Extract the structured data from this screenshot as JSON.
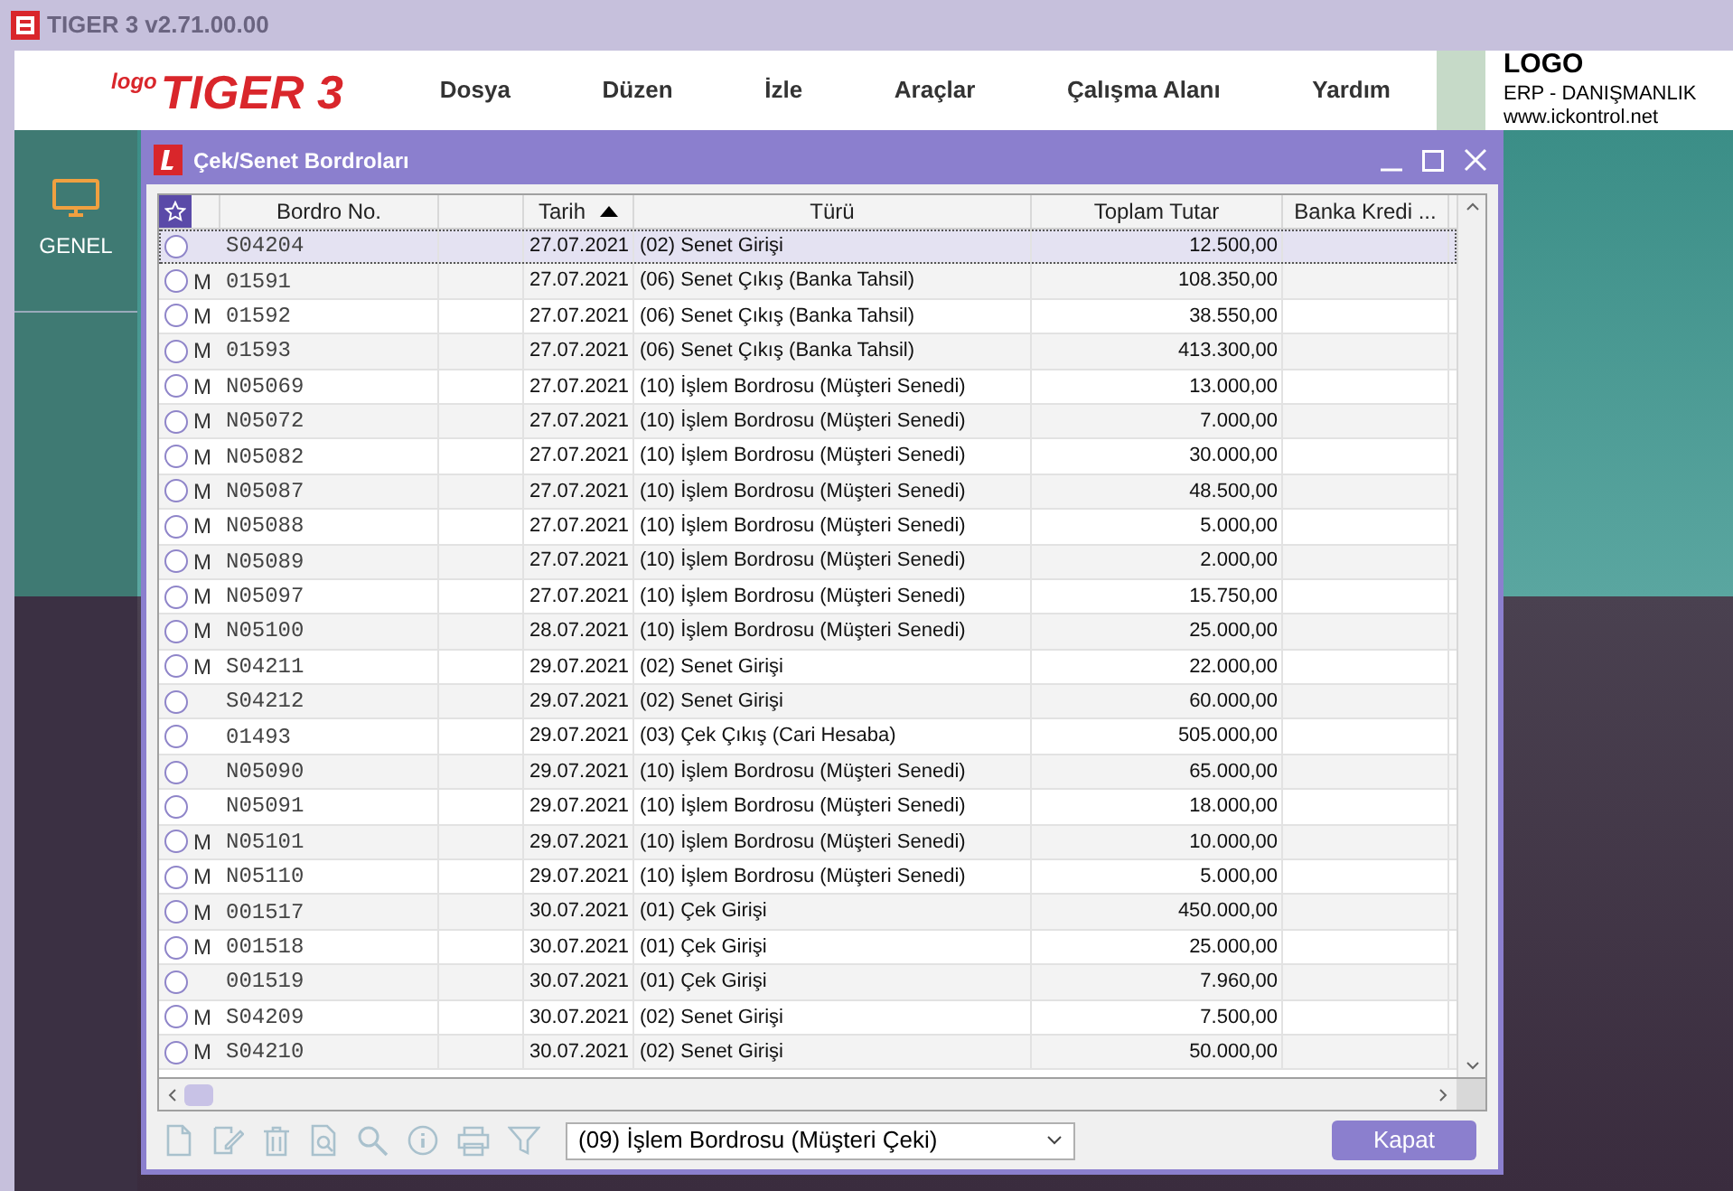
{
  "window": {
    "title": "TIGER 3 v2.71.00.00"
  },
  "brand": {
    "small": "logo",
    "name": "TIGER 3"
  },
  "menu": [
    {
      "label": "Dosya"
    },
    {
      "label": "Düzen"
    },
    {
      "label": "İzle"
    },
    {
      "label": "Araçlar"
    },
    {
      "label": "Çalışma Alanı"
    },
    {
      "label": "Yardım"
    }
  ],
  "company": {
    "name": "LOGO",
    "line": "ERP - DANIŞMANLIK",
    "site": "www.ickontrol.net"
  },
  "sidebar": {
    "items": [
      {
        "label": "GENEL",
        "selected": true
      }
    ]
  },
  "dialog": {
    "title": "Çek/Senet Bordroları",
    "columns": [
      {
        "label": "Bordro No.",
        "sorted": false
      },
      {
        "label": "Tarih",
        "sorted": true
      },
      {
        "label": "Türü",
        "sorted": false
      },
      {
        "label": "Toplam Tutar",
        "sorted": false
      },
      {
        "label": "Banka Kredi ...",
        "sorted": false
      }
    ],
    "rows": [
      {
        "m": "",
        "no": "S04204",
        "date": "27.07.2021",
        "type": "(02) Senet Girişi",
        "amount": "12.500,00",
        "selected": true,
        "checked": false
      },
      {
        "m": "M",
        "no": "01591",
        "date": "27.07.2021",
        "type": "(06) Senet Çıkış (Banka Tahsil)",
        "amount": "108.350,00",
        "selected": false,
        "checked": false
      },
      {
        "m": "M",
        "no": "01592",
        "date": "27.07.2021",
        "type": "(06) Senet Çıkış (Banka Tahsil)",
        "amount": "38.550,00",
        "selected": false,
        "checked": false
      },
      {
        "m": "M",
        "no": "01593",
        "date": "27.07.2021",
        "type": "(06) Senet Çıkış (Banka Tahsil)",
        "amount": "413.300,00",
        "selected": false,
        "checked": false
      },
      {
        "m": "M",
        "no": "N05069",
        "date": "27.07.2021",
        "type": "(10) İşlem Bordrosu (Müşteri Senedi)",
        "amount": "13.000,00",
        "selected": false,
        "checked": false
      },
      {
        "m": "M",
        "no": "N05072",
        "date": "27.07.2021",
        "type": "(10) İşlem Bordrosu (Müşteri Senedi)",
        "amount": "7.000,00",
        "selected": false,
        "checked": false
      },
      {
        "m": "M",
        "no": "N05082",
        "date": "27.07.2021",
        "type": "(10) İşlem Bordrosu (Müşteri Senedi)",
        "amount": "30.000,00",
        "selected": false,
        "checked": false
      },
      {
        "m": "M",
        "no": "N05087",
        "date": "27.07.2021",
        "type": "(10) İşlem Bordrosu (Müşteri Senedi)",
        "amount": "48.500,00",
        "selected": false,
        "checked": false
      },
      {
        "m": "M",
        "no": "N05088",
        "date": "27.07.2021",
        "type": "(10) İşlem Bordrosu (Müşteri Senedi)",
        "amount": "5.000,00",
        "selected": false,
        "checked": false
      },
      {
        "m": "M",
        "no": "N05089",
        "date": "27.07.2021",
        "type": "(10) İşlem Bordrosu (Müşteri Senedi)",
        "amount": "2.000,00",
        "selected": false,
        "checked": false
      },
      {
        "m": "M",
        "no": "N05097",
        "date": "27.07.2021",
        "type": "(10) İşlem Bordrosu (Müşteri Senedi)",
        "amount": "15.750,00",
        "selected": false,
        "checked": false
      },
      {
        "m": "M",
        "no": "N05100",
        "date": "28.07.2021",
        "type": "(10) İşlem Bordrosu (Müşteri Senedi)",
        "amount": "25.000,00",
        "selected": false,
        "checked": false
      },
      {
        "m": "M",
        "no": "S04211",
        "date": "29.07.2021",
        "type": "(02) Senet Girişi",
        "amount": "22.000,00",
        "selected": false,
        "checked": false
      },
      {
        "m": "",
        "no": "S04212",
        "date": "29.07.2021",
        "type": "(02) Senet Girişi",
        "amount": "60.000,00",
        "selected": false,
        "checked": false
      },
      {
        "m": "",
        "no": "01493",
        "date": "29.07.2021",
        "type": "(03) Çek Çıkış (Cari Hesaba)",
        "amount": "505.000,00",
        "selected": false,
        "checked": false
      },
      {
        "m": "",
        "no": "N05090",
        "date": "29.07.2021",
        "type": "(10) İşlem Bordrosu (Müşteri Senedi)",
        "amount": "65.000,00",
        "selected": false,
        "checked": false
      },
      {
        "m": "",
        "no": "N05091",
        "date": "29.07.2021",
        "type": "(10) İşlem Bordrosu (Müşteri Senedi)",
        "amount": "18.000,00",
        "selected": false,
        "checked": false
      },
      {
        "m": "M",
        "no": "N05101",
        "date": "29.07.2021",
        "type": "(10) İşlem Bordrosu (Müşteri Senedi)",
        "amount": "10.000,00",
        "selected": false,
        "checked": false
      },
      {
        "m": "M",
        "no": "N05110",
        "date": "29.07.2021",
        "type": "(10) İşlem Bordrosu (Müşteri Senedi)",
        "amount": "5.000,00",
        "selected": false,
        "checked": false
      },
      {
        "m": "M",
        "no": "001517",
        "date": "30.07.2021",
        "type": "(01) Çek Girişi",
        "amount": "450.000,00",
        "selected": false,
        "checked": false
      },
      {
        "m": "M",
        "no": "001518",
        "date": "30.07.2021",
        "type": "(01) Çek Girişi",
        "amount": "25.000,00",
        "selected": false,
        "checked": false
      },
      {
        "m": "",
        "no": "001519",
        "date": "30.07.2021",
        "type": "(01) Çek Girişi",
        "amount": "7.960,00",
        "selected": false,
        "checked": false
      },
      {
        "m": "M",
        "no": "S04209",
        "date": "30.07.2021",
        "type": "(02) Senet Girişi",
        "amount": "7.500,00",
        "selected": false,
        "checked": false
      },
      {
        "m": "M",
        "no": "S04210",
        "date": "30.07.2021",
        "type": "(02) Senet Girişi",
        "amount": "50.000,00",
        "selected": false,
        "checked": false
      }
    ],
    "filter": {
      "value": "(09) İşlem Bordrosu (Müşteri Çeki)"
    },
    "close_button": "Kapat"
  }
}
